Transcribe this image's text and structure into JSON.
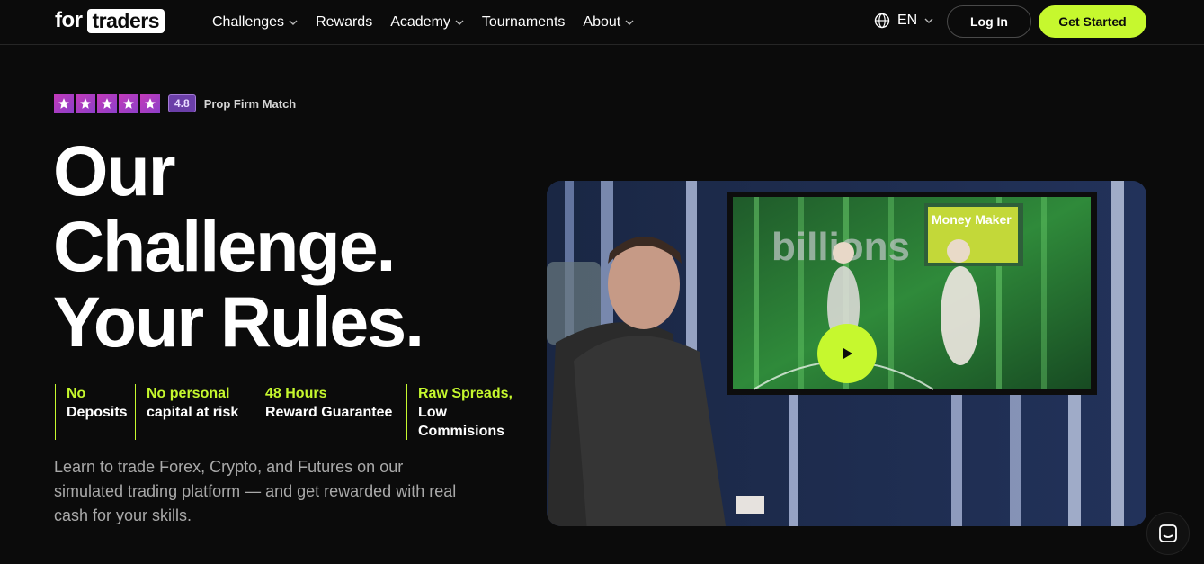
{
  "nav": {
    "logo_for": "for",
    "logo_traders": "traders",
    "items": [
      {
        "label": "Challenges",
        "dropdown": true
      },
      {
        "label": "Rewards",
        "dropdown": false
      },
      {
        "label": "Academy",
        "dropdown": true
      },
      {
        "label": "Tournaments",
        "dropdown": false
      },
      {
        "label": "About",
        "dropdown": true
      }
    ],
    "language": "EN",
    "login": "Log In",
    "get_started": "Get Started"
  },
  "hero": {
    "rating": {
      "stars": 5,
      "score": "4.8",
      "label": "Prop Firm Match"
    },
    "headline": [
      "Our",
      "Challenge.",
      "Your Rules."
    ],
    "features": [
      {
        "highlight": "No",
        "rest": "Deposits"
      },
      {
        "highlight": "No personal",
        "rest": "capital at risk"
      },
      {
        "highlight": "48 Hours",
        "rest": "Reward Guarantee"
      },
      {
        "highlight": "Raw Spreads,",
        "rest": "Low Commisions"
      }
    ],
    "description": "Learn to trade Forex, Crypto, and Futures on our simulated trading platform — and get rewarded with real cash for your skills."
  },
  "video": {
    "screen_text": "billions",
    "poster_text": "Money Maker"
  },
  "colors": {
    "accent": "#c6f82e",
    "background": "#0b0b0b",
    "rating": "#b23bbd"
  }
}
